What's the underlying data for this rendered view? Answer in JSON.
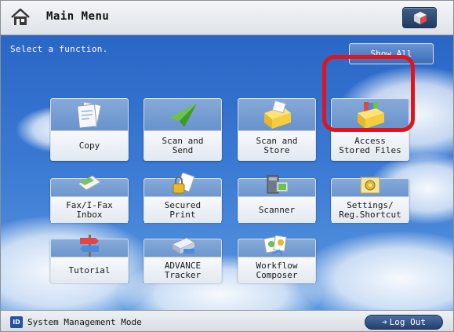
{
  "header": {
    "title": "Main Menu",
    "home_icon": "home-icon",
    "right_button_icon": "cube-icon"
  },
  "main": {
    "prompt": "Select a function.",
    "show_all_label": "Show All",
    "tiles": [
      {
        "label": "Copy",
        "icon": "copy-icon"
      },
      {
        "label": "Scan and\nSend",
        "icon": "paper-plane-icon"
      },
      {
        "label": "Scan and\nStore",
        "icon": "store-box-icon"
      },
      {
        "label": "Access\nStored Files",
        "icon": "stored-files-icon"
      },
      {
        "label": "Fax/I-Fax\nInbox",
        "icon": "fax-inbox-icon"
      },
      {
        "label": "Secured\nPrint",
        "icon": "secured-print-icon"
      },
      {
        "label": "Scanner",
        "icon": "scanner-icon"
      },
      {
        "label": "Settings/\nReg.Shortcut",
        "icon": "settings-icon"
      },
      {
        "label": "Tutorial",
        "icon": "signpost-icon"
      },
      {
        "label": "ADVANCE\nTracker",
        "icon": "tracker-icon"
      },
      {
        "label": "Workflow\nComposer",
        "icon": "workflow-icon"
      }
    ]
  },
  "footer": {
    "id_badge": "ID",
    "mode_label": "System Management Mode",
    "logout_label": "Log Out"
  },
  "colors": {
    "highlight": "#e0141b",
    "sky_top": "#2a66c6",
    "tile": "#6e97cf"
  }
}
